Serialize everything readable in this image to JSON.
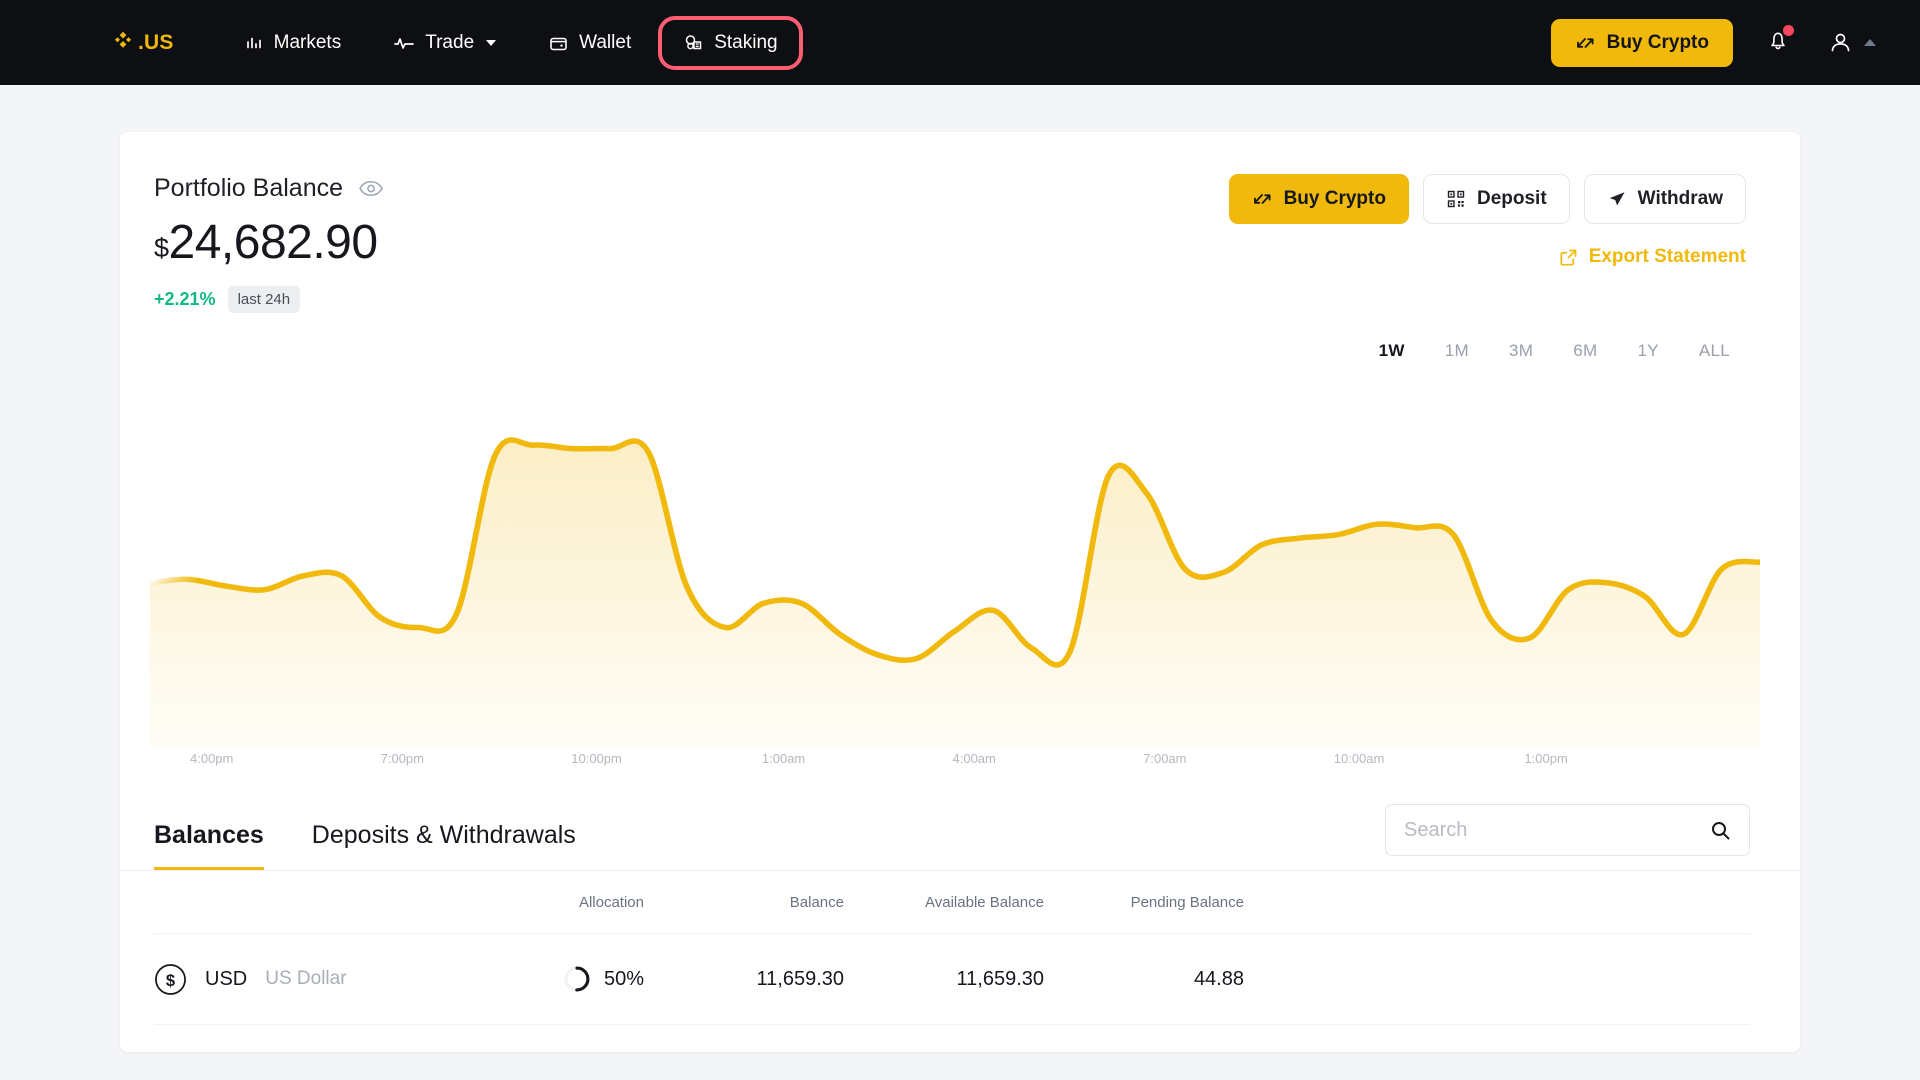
{
  "navbar": {
    "brand": "US",
    "brand_icon": "binance-diamond-icon",
    "items": [
      {
        "label": "Markets",
        "icon": "bar-chart-icon",
        "has_caret": false,
        "highlighted": false
      },
      {
        "label": "Trade",
        "icon": "pulse-line-icon",
        "has_caret": true,
        "highlighted": false
      },
      {
        "label": "Wallet",
        "icon": "wallet-icon",
        "has_caret": false,
        "highlighted": false
      },
      {
        "label": "Staking",
        "icon": "staking-coins-icon",
        "has_caret": false,
        "highlighted": true
      }
    ],
    "buy_crypto_label": "Buy Crypto",
    "highlight_color": "#fb5e72",
    "accent_color": "#f0b90b",
    "notification_dot_color": "#f6465d"
  },
  "portfolio": {
    "title": "Portfolio Balance",
    "currency_symbol": "$",
    "amount": "24,682.90",
    "change": "+2.21%",
    "change_color": "#12b886",
    "change_period": "last 24h",
    "buy_crypto_label": "Buy Crypto",
    "deposit_label": "Deposit",
    "withdraw_label": "Withdraw",
    "export_label": "Export Statement"
  },
  "ranges": {
    "active": "1W",
    "items": [
      "1W",
      "1M",
      "3M",
      "6M",
      "1Y",
      "ALL"
    ]
  },
  "chart_data": {
    "type": "area",
    "title": "Portfolio Balance",
    "xlabel": "",
    "ylabel": "",
    "grid": false,
    "legend": false,
    "line_color": "#f0b90b",
    "fill_color_top": "#fbeec6",
    "fill_color_bottom": "#fffdf6",
    "tick_labels": [
      "4:00pm",
      "7:00pm",
      "10:00pm",
      "1:00am",
      "4:00am",
      "7:00am",
      "10:00am",
      "1:00pm"
    ],
    "x": [
      0,
      1,
      2,
      3,
      4,
      5,
      6,
      7,
      8,
      9,
      10,
      11,
      12,
      13,
      14,
      15,
      16,
      17,
      18,
      19,
      20,
      21,
      22,
      23,
      24,
      25,
      26,
      27,
      28,
      29,
      30,
      31,
      32,
      33,
      34,
      35
    ],
    "values": [
      46,
      47,
      45,
      44,
      48,
      48,
      36,
      33,
      37,
      83,
      86,
      85,
      85,
      84,
      45,
      33,
      40,
      40,
      31,
      25,
      24,
      32,
      38,
      27,
      26,
      77,
      72,
      50,
      49,
      57,
      59,
      60,
      63,
      62,
      60,
      35,
      30,
      44,
      46,
      42,
      31,
      50,
      52
    ],
    "ylim": [
      0,
      100
    ]
  },
  "tabs": {
    "items": [
      "Balances",
      "Deposits & Withdrawals"
    ],
    "active": "Balances"
  },
  "search": {
    "placeholder": "Search",
    "value": "",
    "icon": "search-icon"
  },
  "table": {
    "headers": [
      "",
      "Allocation",
      "Balance",
      "Available Balance",
      "Pending Balance"
    ],
    "rows": [
      {
        "icon": "usd-dollar-coin-icon",
        "symbol": "USD",
        "name": "US Dollar",
        "allocation_pct": "50%",
        "allocation_value": 50,
        "balance": "11,659.30",
        "available_balance": "11,659.30",
        "pending_balance": "44.88"
      }
    ]
  }
}
